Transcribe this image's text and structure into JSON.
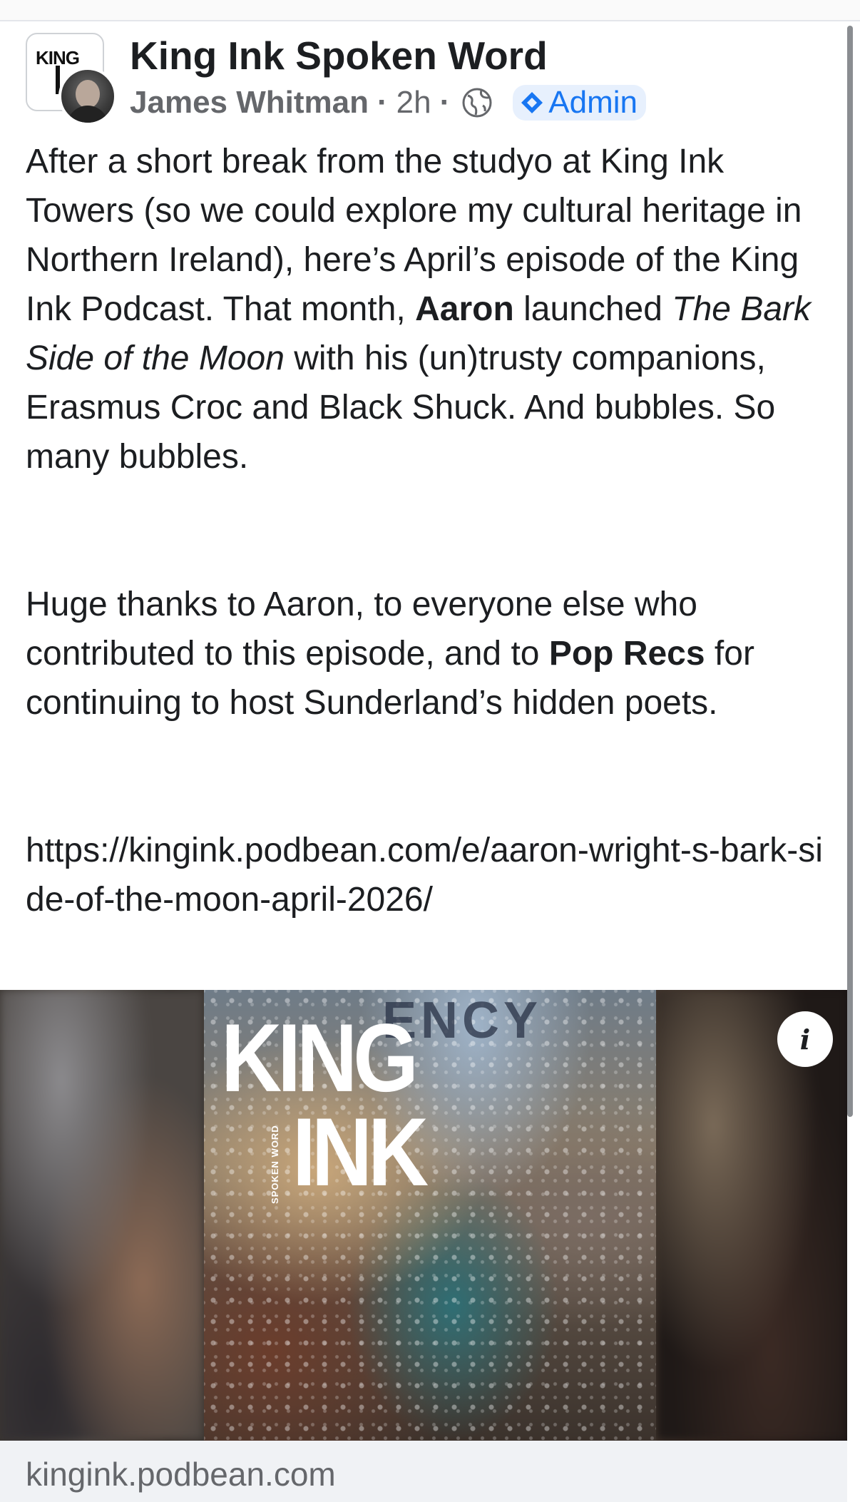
{
  "post": {
    "page_name": "King Ink Spoken Word",
    "page_avatar_text": "KING",
    "author": "James Whitman",
    "time": "2h",
    "separator": "·",
    "audience_icon": "globe-icon",
    "badge": {
      "label": "Admin",
      "icon": "admin-diamond-icon",
      "color": "#1876f2"
    },
    "body": {
      "p1": {
        "t1": "After a short break from the studyo at King Ink Towers (so we could explore my cultural heritage in Northern Ireland), here’s April’s episode of the King Ink Podcast. That month, ",
        "bold1": "Aaron",
        "t2": " launched ",
        "italic1": "The Bark Side of the Moon",
        "t3": " with his (un)trusty companions, Erasmus Croc and Black Shuck. And bubbles. So many bubbles."
      },
      "p2": {
        "t1": "Huge thanks to Aaron, to everyone else who contributed to this episode, and to ",
        "bold1": "Pop Recs",
        "t2": " for continuing to host Sunderland’s hidden poets."
      },
      "link": "https://kingink.podbean.com/e/aaron-wright-s-bark-side-of-the-moon-april-2026/"
    }
  },
  "media": {
    "poster_logo_line1": "KING",
    "poster_logo_line2": "INK",
    "poster_side_text": "SPOKEN WORD",
    "poster_sign_text": "ENCY",
    "info_icon_glyph": "i"
  },
  "link_preview": {
    "domain": "kingink.podbean.com"
  }
}
